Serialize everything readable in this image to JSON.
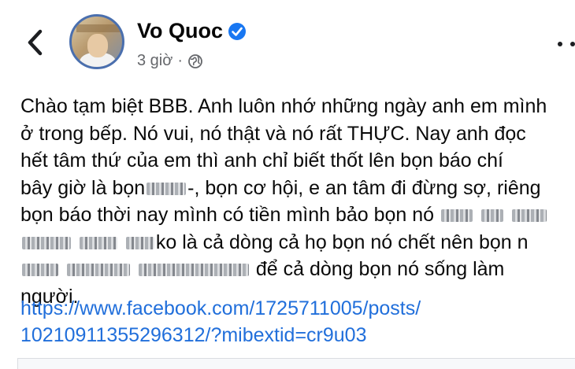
{
  "header": {
    "back_icon": "chevron-left-icon",
    "author_name": "Vo Quoc",
    "verified_icon": "verified-badge-icon",
    "time": "3 giờ",
    "separator": "·",
    "privacy_icon": "globe-icon",
    "more_icon": "more-dots-icon"
  },
  "post": {
    "lines": [
      "Chào tạm biệt BBB. Anh luôn nhớ những ngày anh em mình",
      "ở trong bếp. Nó vui, nó thật và nó rất THỰC. Nay anh đọc",
      "hết tâm thứ của em thì anh chỉ biết thốt lên bọn báo chí"
    ],
    "line4": {
      "a": "bây giờ là bọn",
      "b": "-, bọn cơ hội, e an tâm đi đừng sợ, riêng"
    },
    "line5": {
      "a": "bọn báo thời nay mình có tiền mình bảo bọn nó"
    },
    "line6": {
      "b": "ko là cả dòng cả họ bọn nó chết nên bọn n"
    },
    "line7": {
      "b": "để cả dòng bọn nó sống làm"
    },
    "line8": "người.",
    "link_lines": [
      "https://www.facebook.com/1725711005/posts/",
      "10210911355296312/?mibextid=cr9u03"
    ]
  },
  "colors": {
    "link": "#216fdb",
    "meta_text": "#65676b",
    "verified": "#1877f2"
  }
}
